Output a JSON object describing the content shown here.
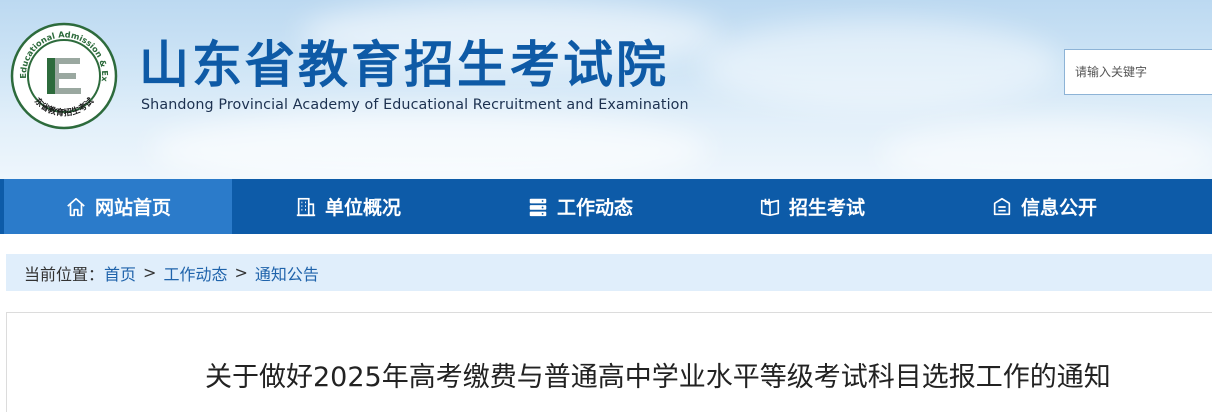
{
  "header": {
    "title": "山东省教育招生考试院",
    "subtitle": "Shandong Provincial Academy of Educational Recruitment and Examination",
    "logo": {
      "ring_text": "Shandong Educational Admission & Examination",
      "inner_text": "山东省教育招生考试院",
      "letter": "E"
    }
  },
  "search": {
    "placeholder": "请输入关键字",
    "icon": "search-field"
  },
  "nav": {
    "items": [
      {
        "label": "网站首页",
        "icon": "home-icon",
        "active": true
      },
      {
        "label": "单位概况",
        "icon": "building-icon"
      },
      {
        "label": "工作动态",
        "icon": "server-icon"
      },
      {
        "label": "招生考试",
        "icon": "book-icon"
      },
      {
        "label": "信息公开",
        "icon": "inbox-icon"
      }
    ]
  },
  "breadcrumb": {
    "prefix": "当前位置：",
    "items": [
      "首页",
      "工作动态",
      "通知公告"
    ],
    "separator": ">"
  },
  "article": {
    "title": "关于做好2025年高考缴费与普通高中学业水平等级考试科目选报工作的通知"
  },
  "colors": {
    "brand_blue": "#0d5ba8",
    "nav_active": "#2b7bca",
    "breadcrumb_bg": "#e0eefb",
    "logo_green": "#2d6b3c"
  }
}
